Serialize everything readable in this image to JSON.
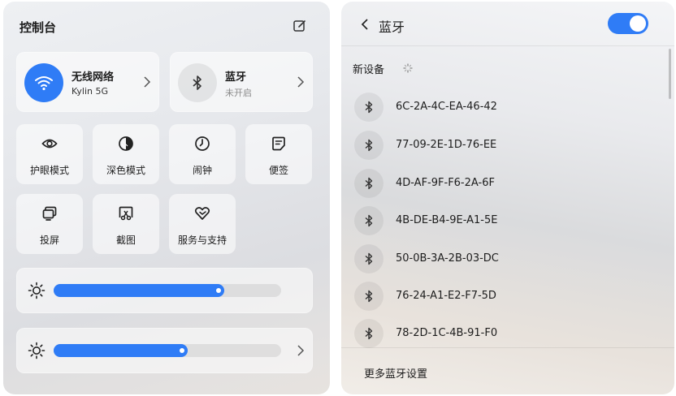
{
  "control_center": {
    "title": "控制台",
    "wifi": {
      "title": "无线网络",
      "subtitle": "Kylin 5G",
      "enabled": true
    },
    "bluetooth": {
      "title": "蓝牙",
      "subtitle": "未开启",
      "enabled": false
    },
    "tiles": [
      {
        "label": "护眼模式",
        "icon": "eye-icon"
      },
      {
        "label": "深色模式",
        "icon": "dark-mode-icon"
      },
      {
        "label": "闹钟",
        "icon": "clock-icon"
      },
      {
        "label": "便签",
        "icon": "note-icon"
      },
      {
        "label": "投屏",
        "icon": "screen-cast-icon"
      },
      {
        "label": "截图",
        "icon": "screenshot-icon"
      },
      {
        "label": "服务与支持",
        "icon": "heart-support-icon"
      }
    ],
    "brightness_slider": {
      "level": 0.75
    },
    "volume_slider": {
      "level": 0.59
    }
  },
  "bluetooth_panel": {
    "title": "蓝牙",
    "toggle_on": true,
    "new_devices_label": "新设备",
    "devices": [
      "6C-2A-4C-EA-46-42",
      "77-09-2E-1D-76-EE",
      "4D-AF-9F-F6-2A-6F",
      "4B-DE-B4-9E-A1-5E",
      "50-0B-3A-2B-03-DC",
      "76-24-A1-E2-F7-5D",
      "78-2D-1C-4B-91-F0"
    ],
    "more_settings": "更多蓝牙设置"
  },
  "colors": {
    "accent": "#2f7cf6"
  }
}
